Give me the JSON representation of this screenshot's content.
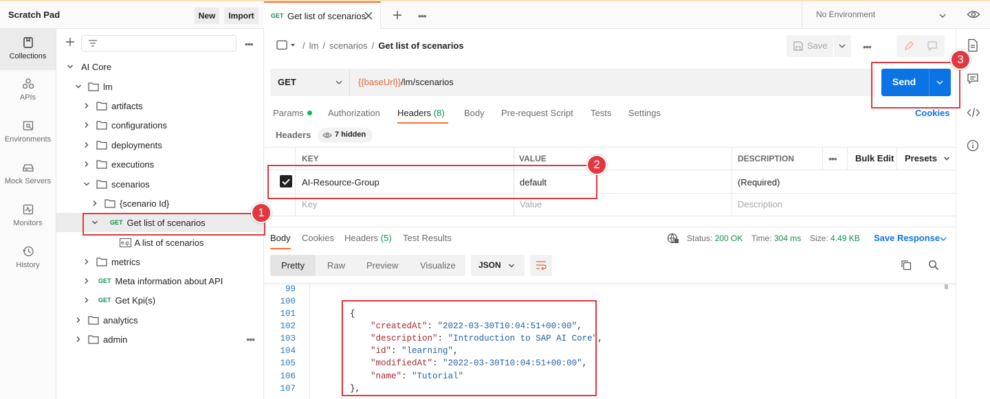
{
  "workspace": {
    "title": "Scratch Pad",
    "new_label": "New",
    "import_label": "Import"
  },
  "rail": [
    {
      "label": "Collections",
      "icon": "collections-icon"
    },
    {
      "label": "APIs",
      "icon": "apis-icon"
    },
    {
      "label": "Environments",
      "icon": "environments-icon"
    },
    {
      "label": "Mock Servers",
      "icon": "mock-servers-icon"
    },
    {
      "label": "Monitors",
      "icon": "monitors-icon"
    },
    {
      "label": "History",
      "icon": "history-icon"
    }
  ],
  "tree": [
    {
      "label": "AI Core",
      "type": "collection",
      "expanded": true
    },
    {
      "label": "lm",
      "type": "folder",
      "expanded": true
    },
    {
      "label": "artifacts",
      "type": "folder"
    },
    {
      "label": "configurations",
      "type": "folder"
    },
    {
      "label": "deployments",
      "type": "folder"
    },
    {
      "label": "executions",
      "type": "folder"
    },
    {
      "label": "scenarios",
      "type": "folder",
      "expanded": true
    },
    {
      "label": "{scenario Id}",
      "type": "folder"
    },
    {
      "label": "Get list of scenarios",
      "type": "request",
      "method": "GET",
      "expanded": true
    },
    {
      "label": "A list of scenarios",
      "type": "example",
      "tag": "e.g."
    },
    {
      "label": "metrics",
      "type": "folder"
    },
    {
      "label": "Meta information about API",
      "type": "request",
      "method": "GET"
    },
    {
      "label": "Get Kpi(s)",
      "type": "request",
      "method": "GET"
    },
    {
      "label": "analytics",
      "type": "folder"
    },
    {
      "label": "admin",
      "type": "folder"
    }
  ],
  "tab": {
    "method": "GET",
    "label": "Get list of scenarios"
  },
  "environment": {
    "label": "No Environment"
  },
  "breadcrumb": {
    "seg1": "lm",
    "seg2": "scenarios",
    "current": "Get list of scenarios"
  },
  "request": {
    "save_label": "Save",
    "method": "GET",
    "url_var": "{{baseUrl}}",
    "url_path": "/lm/scenarios",
    "send_label": "Send",
    "cookies_label": "Cookies"
  },
  "req_tabs": {
    "params": "Params",
    "authorization": "Authorization",
    "headers": "Headers",
    "headers_count": "(8)",
    "body": "Body",
    "prerequest": "Pre-request Script",
    "tests": "Tests",
    "settings": "Settings"
  },
  "headers_section": {
    "title": "Headers",
    "hidden": "7 hidden"
  },
  "headers_table": {
    "col_key": "KEY",
    "col_value": "VALUE",
    "col_description": "DESCRIPTION",
    "bulk_edit": "Bulk Edit",
    "presets": "Presets",
    "row": {
      "checked": true,
      "key": "AI-Resource-Group",
      "value": "default",
      "description": "(Required)"
    },
    "placeholder": {
      "key": "Key",
      "value": "Value",
      "description": "Description"
    }
  },
  "response": {
    "tabs": {
      "body": "Body",
      "cookies": "Cookies",
      "headers": "Headers",
      "headers_count": "(5)",
      "test_results": "Test Results"
    },
    "status_label": "Status:",
    "status_value": "200 OK",
    "time_label": "Time:",
    "time_value": "304 ms",
    "size_label": "Size:",
    "size_value": "4.49 KB",
    "save_response": "Save Response",
    "formats": {
      "pretty": "Pretty",
      "raw": "Raw",
      "preview": "Preview",
      "visualize": "Visualize"
    },
    "language": "JSON"
  },
  "code_lines": [
    {
      "n": "99"
    },
    {
      "n": "100"
    },
    {
      "n": "101"
    },
    {
      "n": "102",
      "key": "\"createdAt\"",
      "val": "\"2022-03-30T10:04:51+00:00\""
    },
    {
      "n": "103",
      "key": "\"description\"",
      "val": "\"Introduction to SAP AI Core\""
    },
    {
      "n": "104",
      "key": "\"id\"",
      "val": "\"learning\""
    },
    {
      "n": "105",
      "key": "\"modifiedAt\"",
      "val": "\"2022-03-30T10:04:51+00:00\""
    },
    {
      "n": "106",
      "key": "\"name\"",
      "val": "\"Tutorial\""
    },
    {
      "n": "107"
    }
  ],
  "annotations": [
    "1",
    "2",
    "3"
  ],
  "colors": {
    "accent": "#ff6c37",
    "send": "#0b74e5",
    "highlight": "#e0383e",
    "get": "#0f8f4a"
  }
}
